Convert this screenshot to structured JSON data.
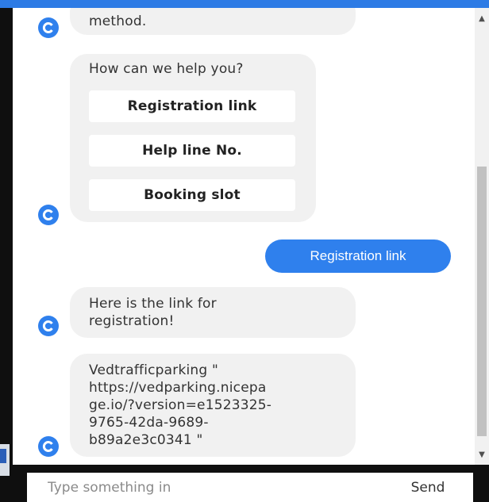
{
  "messages": {
    "bot_partial": "method.",
    "menu": {
      "prompt": "How can we help you?",
      "options": [
        "Registration link",
        "Help line No.",
        "Booking slot"
      ]
    },
    "user_reply": "Registration link",
    "bot_reply_1": [
      "Here is the link for",
      "registration!"
    ],
    "bot_reply_2": [
      "Vedtrafficparking \"",
      "https://vedparking.nicepa",
      "ge.io/?version=e1523325-",
      "9765-42da-9689-",
      "b89a2e3c0341 \""
    ]
  },
  "composer": {
    "placeholder": "Type something in",
    "send_label": "Send"
  },
  "colors": {
    "accent": "#2f80ed",
    "bot_bubble": "#f1f1f1"
  },
  "icons": {
    "bot_avatar": "chatbot-avatar-icon"
  }
}
